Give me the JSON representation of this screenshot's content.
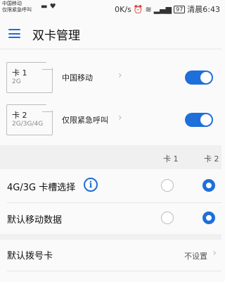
{
  "status_bar": {
    "carrier_line1": "中国移动",
    "carrier_line2": "仅限紧急呼叫",
    "icons": [
      "briefcase-icon",
      "heart-icon"
    ],
    "speed": "0K/s",
    "battery": "97",
    "time": "清晨6:43"
  },
  "app_bar": {
    "title": "双卡管理"
  },
  "sims": [
    {
      "name": "卡 1",
      "network": "2G",
      "carrier": "中国移动",
      "enabled": true
    },
    {
      "name": "卡 2",
      "network": "2G/3G/4G",
      "carrier": "仅限紧急呼叫",
      "enabled": true
    }
  ],
  "columns": {
    "card1": "卡 1",
    "card2": "卡 2"
  },
  "options": [
    {
      "label": "4G/3G 卡槽选择",
      "has_info": true,
      "selected": "card2"
    },
    {
      "label": "默认移动数据",
      "has_info": false,
      "selected": "card2"
    }
  ],
  "default_dial": {
    "label": "默认拨号卡",
    "value": "不设置"
  },
  "colors": {
    "accent": "#1e6fd9",
    "background": "#fafafa"
  }
}
